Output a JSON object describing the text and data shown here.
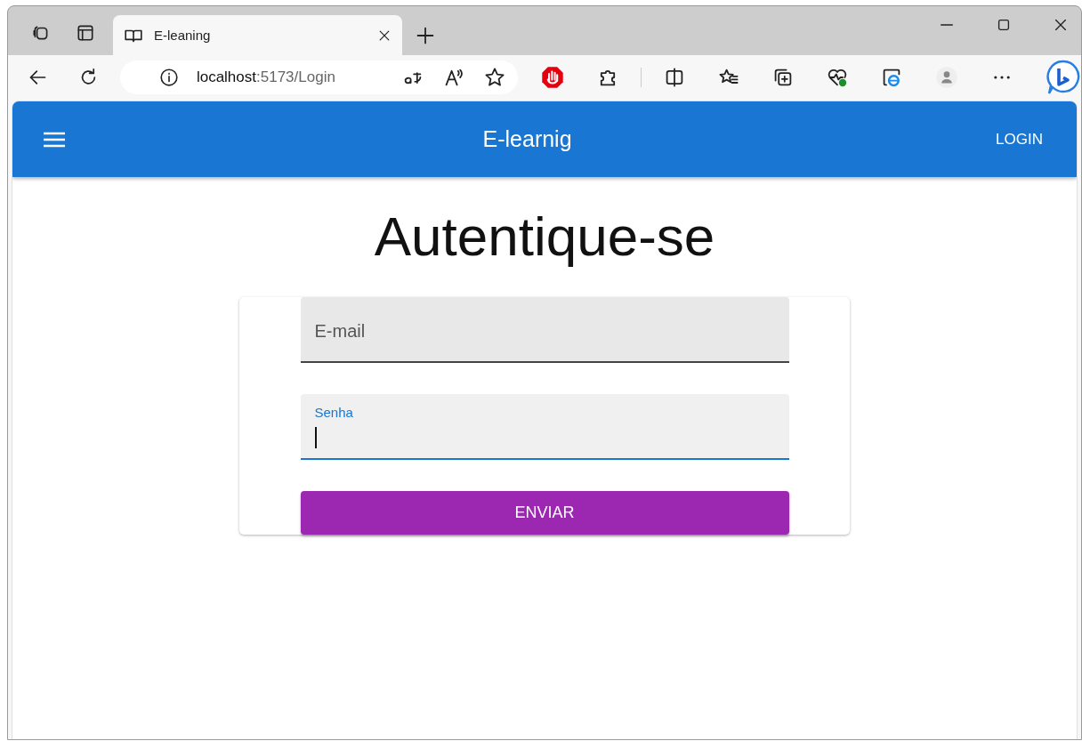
{
  "browser": {
    "tab_title": "E-leaning",
    "address": "**localhost**:5173/Login"
  },
  "app_bar": {
    "title": "E-learnig",
    "action": "LOGIN"
  },
  "heading": "Autentique-se",
  "fields": [
    {
      "label": "E-mail",
      "focused": false
    },
    {
      "label": "Senha",
      "focused": true
    }
  ],
  "submit": "ENVIAR"
}
